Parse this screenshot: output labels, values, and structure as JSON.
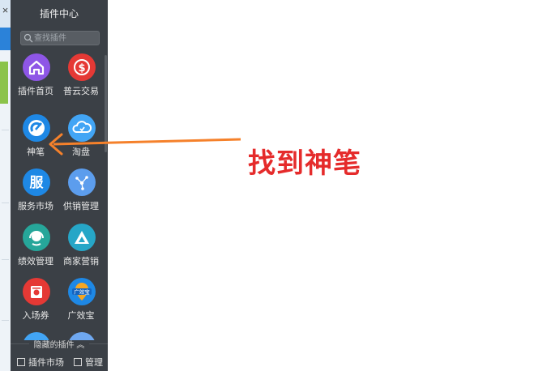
{
  "panel": {
    "title": "插件中心",
    "search_placeholder": "查找插件"
  },
  "plugins": [
    {
      "label": "插件首页",
      "icon": "home-icon",
      "color": "#8e56e6"
    },
    {
      "label": "普云交易",
      "icon": "dollar-icon",
      "color": "#e53935"
    },
    {
      "label": "神笔",
      "icon": "pen-icon",
      "color": "#1e88e5"
    },
    {
      "label": "淘盘",
      "icon": "cloud-icon",
      "color": "#42a5f5"
    },
    {
      "label": "服务市场",
      "icon": "service-icon",
      "color": "#1e88e5"
    },
    {
      "label": "供销管理",
      "icon": "network-icon",
      "color": "#5c9ded"
    },
    {
      "label": "绩效管理",
      "icon": "headset-icon",
      "color": "#26a69a"
    },
    {
      "label": "商家营销",
      "icon": "triangle-icon",
      "color": "#26a6c7"
    },
    {
      "label": "入场券",
      "icon": "ticket-icon",
      "color": "#e53935"
    },
    {
      "label": "广效宝",
      "icon": "location-badge-icon",
      "color": "#1e88e5",
      "badge_text": "广效宝"
    }
  ],
  "footer": {
    "hidden_label": "隐藏的插件",
    "hidden_toggle_glyph": "≈",
    "market_label": "插件市场",
    "manage_label": "管理"
  },
  "annotation": {
    "text": "找到神笔",
    "color": "#e52b2b",
    "arrow_color": "#f5812b"
  },
  "window": {
    "close_glyph": "×"
  }
}
